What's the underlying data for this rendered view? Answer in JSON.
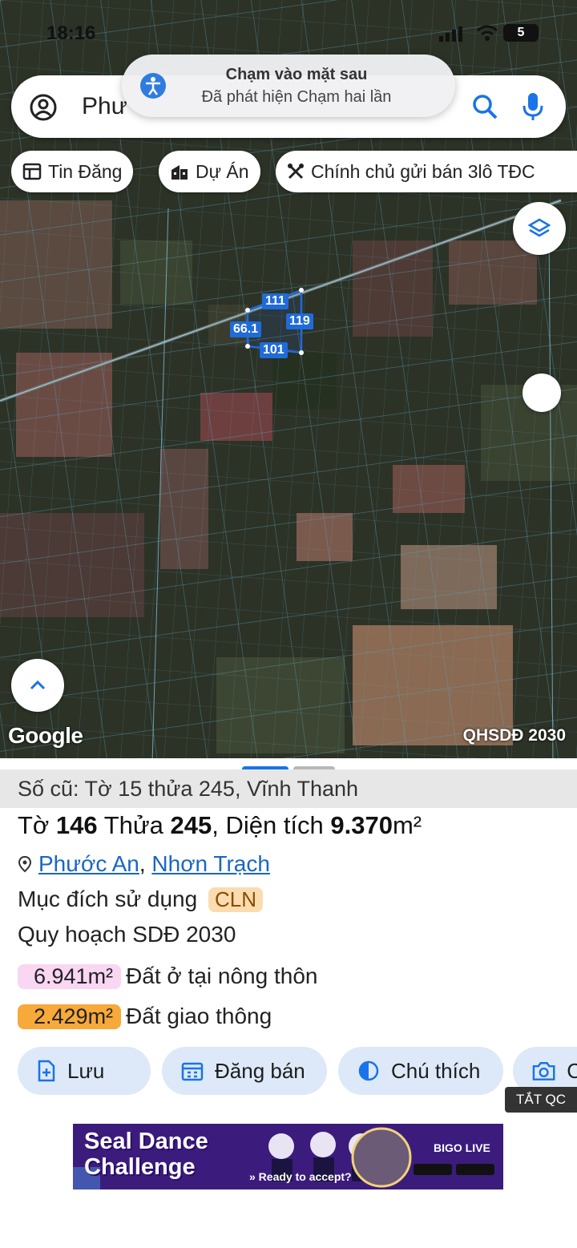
{
  "status": {
    "time": "18:16",
    "battery": "5"
  },
  "search": {
    "text": "Phư"
  },
  "toast": {
    "title": "Chạm vào mặt sau",
    "subtitle": "Đã phát hiện Chạm hai lần"
  },
  "chips": [
    {
      "label": "Tin Đăng",
      "icon": "newspaper-icon"
    },
    {
      "label": "Dự Án",
      "icon": "building-icon"
    },
    {
      "label": "Chính chủ gửi bán 3lô TĐC",
      "icon": "tools-icon"
    }
  ],
  "parcel_labels": {
    "top": "111",
    "left": "66.1",
    "right": "119",
    "bottom": "101"
  },
  "map": {
    "google": "Google",
    "plan_label": "QHSDĐ 2030"
  },
  "sheet": {
    "old_info": "Số cũ: Tờ 15 thửa 245, Vĩnh Thanh",
    "to_label": "Tờ",
    "to_value": "146",
    "thua_label": "Thửa",
    "thua_value": "245",
    "area_label": ", Diện tích",
    "area_value": "9.370",
    "area_unit": "m²",
    "ward": "Phước An",
    "district": "Nhơn Trạch",
    "purpose_label": "Mục đích sử dụng",
    "purpose_code": "CLN",
    "plan_title": "Quy hoạch SDĐ 2030",
    "zones": [
      {
        "area": "6.941m²",
        "label": "Đất ở tại nông thôn",
        "color": "#f9d6f2"
      },
      {
        "area": "2.429m²",
        "label": "Đất giao thông",
        "color": "#f7a93a"
      }
    ],
    "actions": [
      {
        "label": "Lưu",
        "icon": "add-document-icon"
      },
      {
        "label": "Đăng bán",
        "icon": "calendar-icon"
      },
      {
        "label": "Chú thích",
        "icon": "contrast-icon"
      },
      {
        "label": "C",
        "icon": "camera-icon"
      }
    ],
    "ad_off": "TẮT QC",
    "ad": {
      "line1": "Seal Dance",
      "line2": "Challenge",
      "cta": "» Ready to accept?",
      "brand": "BIGO LIVE"
    }
  }
}
